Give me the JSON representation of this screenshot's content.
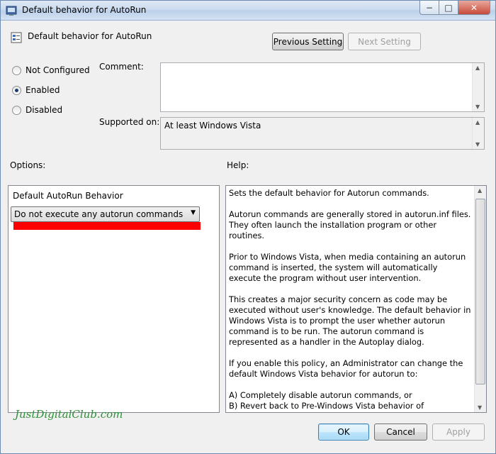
{
  "window": {
    "title": "Default behavior for AutoRun",
    "controls": {
      "minimize": "−",
      "maximize": "□",
      "close": "✕"
    }
  },
  "header": {
    "title": "Default behavior for AutoRun",
    "prev_label": "Previous Setting",
    "next_label": "Next Setting"
  },
  "state": {
    "options": [
      {
        "label": "Not Configured",
        "selected": false
      },
      {
        "label": "Enabled",
        "selected": true
      },
      {
        "label": "Disabled",
        "selected": false
      }
    ]
  },
  "comment": {
    "label": "Comment:",
    "value": ""
  },
  "supported": {
    "label": "Supported on:",
    "value": "At least Windows Vista"
  },
  "options_section": {
    "label": "Options:",
    "setting_label": "Default AutoRun Behavior",
    "selected_value": "Do not execute any autorun commands"
  },
  "help": {
    "label": "Help:",
    "text": "Sets the default behavior for Autorun commands.\n\nAutorun commands are generally stored in autorun.inf files. They often launch the installation program or other routines.\n\nPrior to Windows Vista, when media containing an autorun command is inserted, the system will automatically execute the program without user intervention.\n\nThis creates a major security concern as code may be executed without user's knowledge. The default behavior in Windows Vista is to prompt the user whether autorun command is to be run. The autorun command is represented as a handler in the Autoplay dialog.\n\nIf you enable this policy, an Administrator can change the default Windows Vista behavior for autorun to:\n\nA) Completely disable autorun commands, or\nB) Revert back to Pre-Windows Vista behavior of automatically executing the autorun command."
  },
  "footer": {
    "ok_label": "OK",
    "cancel_label": "Cancel",
    "apply_label": "Apply"
  },
  "watermark": "JustDigitalClub.com",
  "colors": {
    "highlight_bar": "#ff0000",
    "watermark": "#2f8f3a"
  }
}
